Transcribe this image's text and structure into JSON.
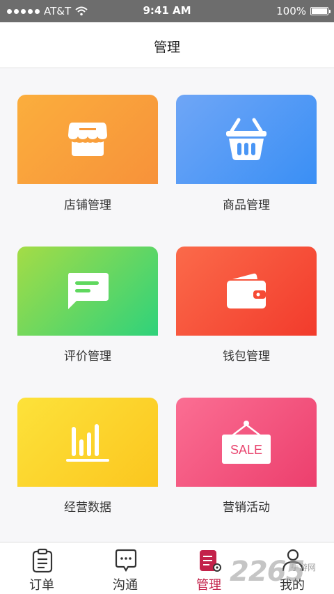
{
  "status_bar": {
    "carrier": "AT&T",
    "time": "9:41 AM",
    "battery": "100%",
    "battery_level": 1.0
  },
  "header": {
    "title": "管理"
  },
  "menu": [
    {
      "label": "店铺管理",
      "icon": "storefront-icon",
      "color": "#f89a3b"
    },
    {
      "label": "商品管理",
      "icon": "shopping-basket-icon",
      "color": "#4a96f5"
    },
    {
      "label": "评价管理",
      "icon": "comment-icon",
      "color": "#5fd85e"
    },
    {
      "label": "钱包管理",
      "icon": "wallet-icon",
      "color": "#f64a34"
    },
    {
      "label": "经营数据",
      "icon": "bar-chart-icon",
      "color": "#fcd12a"
    },
    {
      "label": "营销活动",
      "icon": "sale-sign-icon",
      "color": "#f04f7b"
    }
  ],
  "sale_sign_text": "SALE",
  "tabs": [
    {
      "label": "订单",
      "icon": "clipboard-icon",
      "active": false
    },
    {
      "label": "沟通",
      "icon": "chat-bubble-icon",
      "active": false
    },
    {
      "label": "管理",
      "icon": "manage-icon",
      "active": true
    },
    {
      "label": "我的",
      "icon": "user-icon",
      "active": false
    }
  ],
  "active_color": "#c3224a",
  "watermark": {
    "text": "2265",
    "sub": "手游网"
  }
}
